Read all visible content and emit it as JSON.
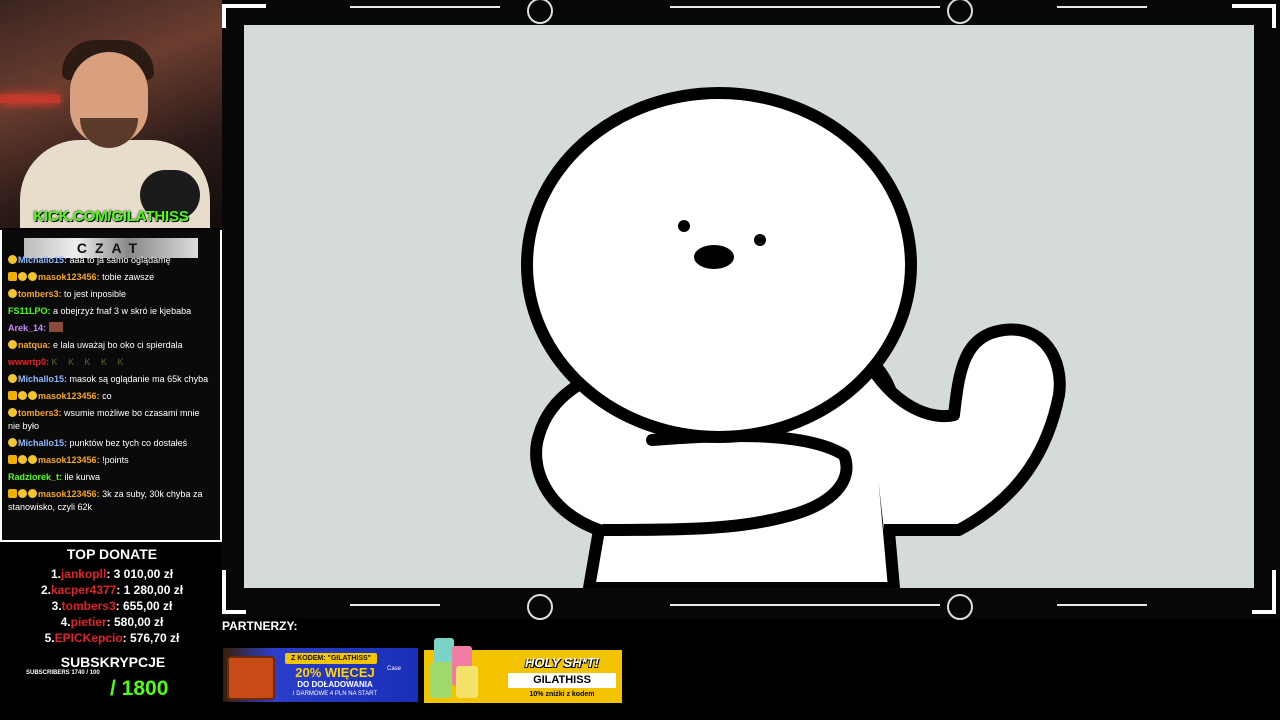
{
  "stream": {
    "kick_url": "KICK.COM/GILATHISS",
    "chat_title": "CZAT"
  },
  "chat": [
    {
      "user": "Michallo15",
      "text": "aaa to ja samo oglądamę",
      "color": "#8fb8ff",
      "badges": [
        "sub"
      ]
    },
    {
      "user": "masok123456",
      "text": "tobie zawsze",
      "color": "#f5a623",
      "badges": [
        "crown",
        "sub",
        "sub"
      ]
    },
    {
      "user": "tombers3",
      "text": "to jest inposible",
      "color": "#f5a623",
      "badges": [
        "sub"
      ]
    },
    {
      "user": "FS11LPO",
      "text": "a obejrzyż fnaf 3 w skró ie kjebaba",
      "color": "#53fc18",
      "badges": []
    },
    {
      "user": "Arek_14",
      "text": "",
      "color": "#c88cff",
      "badges": [],
      "sticker": true
    },
    {
      "user": "natqua",
      "text": "e lala uważaj bo oko ci spierdala",
      "color": "#f5a623",
      "badges": [
        "sub"
      ]
    },
    {
      "user": "wwwrtp0",
      "text": "K K K K K",
      "color": "#e0242a",
      "badges": [],
      "faint": true
    },
    {
      "user": "Michallo15",
      "text": "masok są oglądanie ma 65k chyba",
      "color": "#8fb8ff",
      "badges": [
        "sub"
      ]
    },
    {
      "user": "masok123456",
      "text": "co",
      "color": "#f5a623",
      "badges": [
        "crown",
        "sub",
        "sub"
      ]
    },
    {
      "user": "tombers3",
      "text": "wsumie możliwe bo czasami mnie nie było",
      "color": "#f5a623",
      "badges": [
        "sub"
      ]
    },
    {
      "user": "Michallo15",
      "text": "punktów bez tych co dostałeś",
      "color": "#8fb8ff",
      "badges": [
        "sub"
      ]
    },
    {
      "user": "masok123456",
      "text": "!points",
      "color": "#f5a623",
      "badges": [
        "crown",
        "sub",
        "sub"
      ]
    },
    {
      "user": "Radziorek_t",
      "text": "ile kurwa",
      "color": "#53fc18",
      "badges": []
    },
    {
      "user": "masok123456",
      "text": "3k za suby, 30k chyba za stanowisko, czyli 62k",
      "color": "#f5a623",
      "badges": [
        "crown",
        "sub",
        "sub"
      ]
    }
  ],
  "top_donate": {
    "title": "TOP DONATE",
    "entries": [
      {
        "rank": "1.",
        "name": "jankopll",
        "amount": ": 3 010,00 zł"
      },
      {
        "rank": "2.",
        "name": "kacper4377",
        "amount": ": 1 280,00 zł"
      },
      {
        "rank": "3.",
        "name": "tombers3",
        "amount": ": 655,00 zł"
      },
      {
        "rank": "4.",
        "name": "pietier",
        "amount": ": 580,00 zł"
      },
      {
        "rank": "5.",
        "name": "EPICKepcio",
        "amount": ": 576,70 zł"
      }
    ]
  },
  "subs": {
    "title": "SUBSKRYPCJE",
    "small": "SUBSCRIBERS 1740 / 100",
    "goal": "/ 1800"
  },
  "partners": {
    "label": "PARTNERZY:",
    "banner1": {
      "code": "Z KODEM: \"GILATHISS\"",
      "big": "20% WIĘCEJ",
      "line2": "DO DOŁADOWANIA",
      "line3": "I DARMOWE 4 PLN NA START",
      "brand": "Case"
    },
    "banner2": {
      "title": "HOLY SH*T!",
      "code": "GILATHISS",
      "note": "10% zniżki z kodem"
    }
  },
  "colors": {
    "kick_green": "#53fc18",
    "donate_red": "#e0242a",
    "canvas_bg": "#d5dbd9"
  }
}
